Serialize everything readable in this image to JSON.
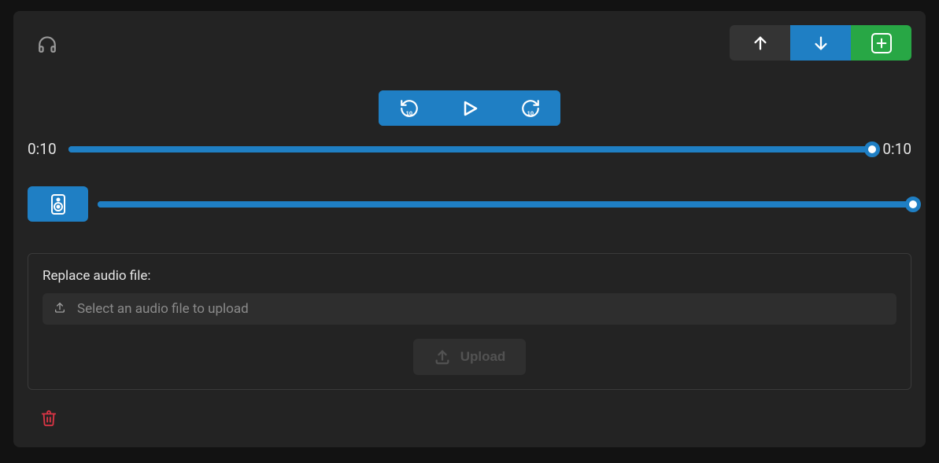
{
  "player": {
    "current_time": "0:10",
    "duration": "0:10",
    "progress_percent": 100,
    "volume_percent": 100
  },
  "replace_section": {
    "label": "Replace audio file:",
    "file_placeholder": "Select an audio file to upload",
    "upload_button": "Upload"
  },
  "icons": {
    "headphones": "headphones-icon",
    "arrow_up": "arrow-up-icon",
    "arrow_down": "arrow-down-icon",
    "plus_square": "plus-square-icon",
    "rewind_10": "rewind-10-icon",
    "play": "play-icon",
    "forward_10": "forward-10-icon",
    "speaker": "speaker-icon",
    "upload_small": "upload-icon",
    "upload_large": "upload-icon",
    "trash": "trash-icon"
  }
}
